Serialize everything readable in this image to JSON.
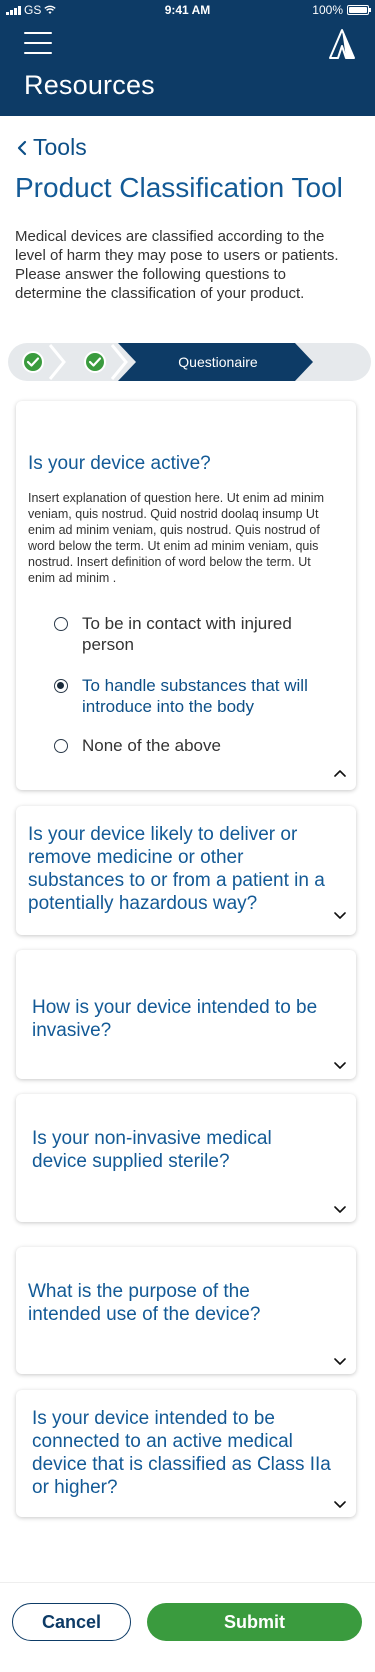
{
  "status_bar": {
    "carrier": "GS",
    "time": "9:41 AM",
    "battery": "100%"
  },
  "header": {
    "title": "Resources",
    "menu_icon": "hamburger-menu-icon",
    "logo_icon": "app-logo-icon"
  },
  "breadcrumb": {
    "back_label": "Tools"
  },
  "page": {
    "title": "Product Classification Tool",
    "intro": "Medical devices are classified according to the level of harm they may pose to users or patients. Please answer the following questions to determine the classification of your product."
  },
  "stepper": {
    "steps": [
      {
        "status": "complete"
      },
      {
        "status": "complete"
      },
      {
        "label": "Questionaire",
        "status": "active"
      },
      {
        "status": "pending"
      }
    ]
  },
  "questions": [
    {
      "question": "Is your device active?",
      "expanded": true,
      "explanation": "Insert explanation of question here.  Ut enim ad minim veniam, quis nostrud. Quid nostrid doolaq insump Ut enim ad minim veniam, quis nostrud. Quis nostrud of word below the term. Ut enim ad minim veniam, quis nostrud. Insert definition of word below the term. Ut enim ad minim .",
      "options": [
        {
          "label": "To be in contact with injured person",
          "selected": false
        },
        {
          "label": "To handle substances that will introduce into the body",
          "selected": true
        },
        {
          "label": "None of the above",
          "selected": false
        }
      ]
    },
    {
      "question": "Is your device likely to deliver or remove medicine or other substances to or from a patient in a potentially hazardous way?",
      "expanded": false
    },
    {
      "question": "How is your device intended to be invasive?",
      "expanded": false
    },
    {
      "question": "Is your non-invasive medical device supplied sterile?",
      "expanded": false
    },
    {
      "question": "What is the purpose of the intended use of the device?",
      "expanded": false
    },
    {
      "question": "Is your device intended to be connected to an active medical device that is classified as Class IIa or higher?",
      "expanded": false
    }
  ],
  "actions": {
    "cancel_label": "Cancel",
    "submit_label": "Submit"
  },
  "colors": {
    "brand_navy": "#0d3b66",
    "link_blue": "#135a96",
    "success_green": "#3a9b3e",
    "pending_gray": "#e6e9ec"
  }
}
